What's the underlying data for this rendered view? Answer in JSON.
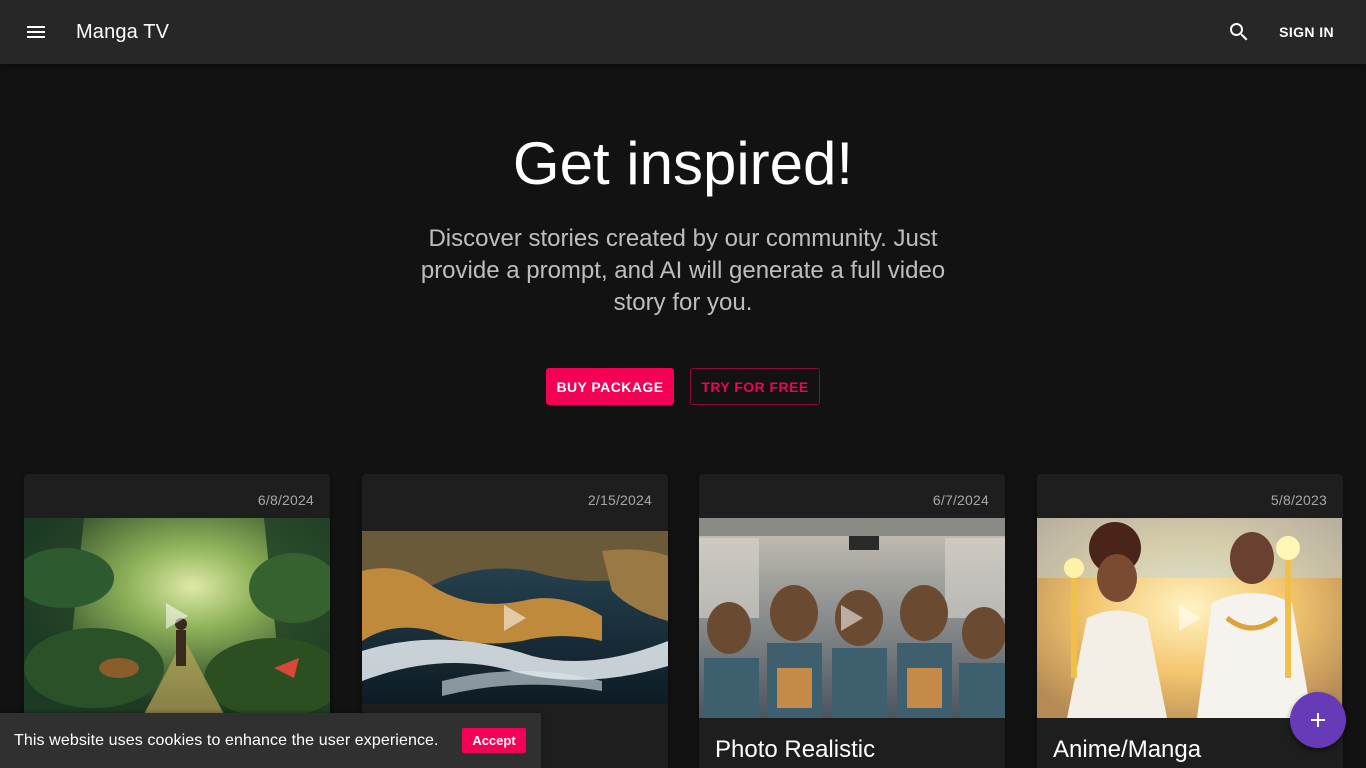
{
  "appbar": {
    "title": "Manga TV",
    "signin_label": "SIGN IN",
    "menu_icon": "menu-icon",
    "search_icon": "search-icon"
  },
  "hero": {
    "title": "Get inspired!",
    "subtitle": "Discover stories created by our community. Just provide a prompt, and AI will generate a full video story for you.",
    "buy_label": "BUY PACKAGE",
    "try_label": "TRY FOR FREE"
  },
  "cards": [
    {
      "date": "6/8/2024",
      "title": ""
    },
    {
      "date": "2/15/2024",
      "title": ""
    },
    {
      "date": "6/7/2024",
      "title": "Photo Realistic"
    },
    {
      "date": "5/8/2023",
      "title": "Anime/Manga"
    }
  ],
  "cookie": {
    "text": "This website uses cookies to enhance the user experience.",
    "accept_label": "Accept"
  },
  "fab": {
    "icon": "plus-icon"
  },
  "colors": {
    "accent": "#f50057",
    "fab": "#673ab7",
    "appbar": "#272727",
    "background": "#121212"
  }
}
